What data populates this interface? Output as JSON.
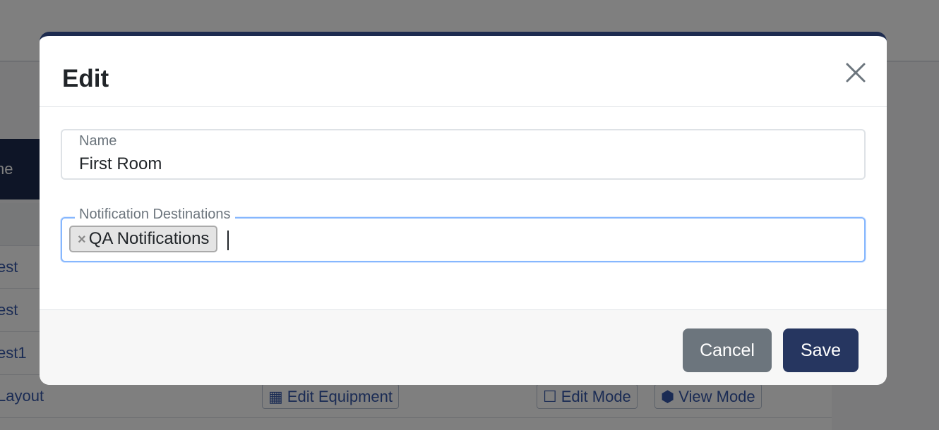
{
  "background": {
    "tab_label": "ne",
    "rows": [
      {
        "name": "est"
      },
      {
        "name": "est"
      },
      {
        "name": "est1"
      },
      {
        "name": "Layout",
        "buttons": [
          "Edit Equipment",
          "Edit Mode",
          "View Mode"
        ]
      }
    ]
  },
  "modal": {
    "title": "Edit",
    "fields": {
      "name": {
        "label": "Name",
        "value": "First Room"
      },
      "notification_destinations": {
        "label": "Notification Destinations",
        "chips": [
          {
            "label": "QA Notifications",
            "remove_glyph": "×"
          }
        ]
      }
    },
    "footer": {
      "cancel_label": "Cancel",
      "save_label": "Save"
    }
  },
  "colors": {
    "accent": "#263660",
    "cancel": "#6c757d",
    "focus": "#86b7fe"
  }
}
